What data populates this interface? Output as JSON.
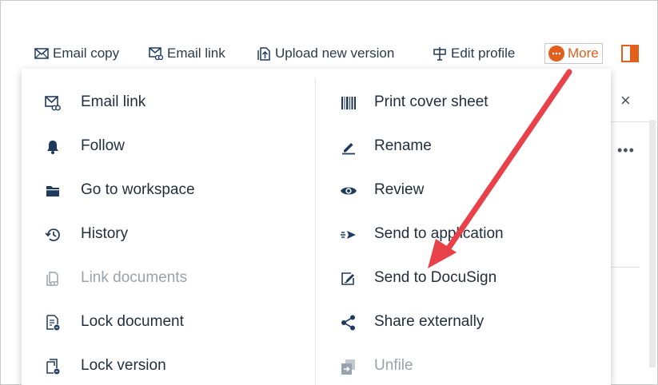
{
  "toolbar": {
    "email_copy": "Email copy",
    "email_link": "Email link",
    "upload_new_version": "Upload new version",
    "edit_profile": "Edit profile",
    "more": "More"
  },
  "panel": {
    "close_glyph": "×",
    "kebab_glyph": "•••"
  },
  "menu": {
    "left": [
      {
        "label": "Email link",
        "icon": "email-link-icon",
        "disabled": false
      },
      {
        "label": "Follow",
        "icon": "bell-icon",
        "disabled": false
      },
      {
        "label": "Go to workspace",
        "icon": "folder-icon",
        "disabled": false
      },
      {
        "label": "History",
        "icon": "history-icon",
        "disabled": false
      },
      {
        "label": "Link documents",
        "icon": "link-documents-icon",
        "disabled": true
      },
      {
        "label": "Lock document",
        "icon": "lock-document-icon",
        "disabled": false
      },
      {
        "label": "Lock version",
        "icon": "lock-version-icon",
        "disabled": false
      }
    ],
    "right": [
      {
        "label": "Print cover sheet",
        "icon": "barcode-icon",
        "disabled": false
      },
      {
        "label": "Rename",
        "icon": "pencil-icon",
        "disabled": false
      },
      {
        "label": "Review",
        "icon": "eye-icon",
        "disabled": false
      },
      {
        "label": "Send to application",
        "icon": "send-arrow-icon",
        "disabled": false
      },
      {
        "label": "Send to DocuSign",
        "icon": "docusign-icon",
        "disabled": false
      },
      {
        "label": "Share externally",
        "icon": "share-icon",
        "disabled": false
      },
      {
        "label": "Unfile",
        "icon": "unfile-icon",
        "disabled": true
      }
    ]
  },
  "colors": {
    "accent": "#e0601c",
    "text": "#1f2d3d",
    "icon": "#1f3a5f",
    "disabled": "#9aa3ad",
    "arrow": "#e8414a"
  }
}
